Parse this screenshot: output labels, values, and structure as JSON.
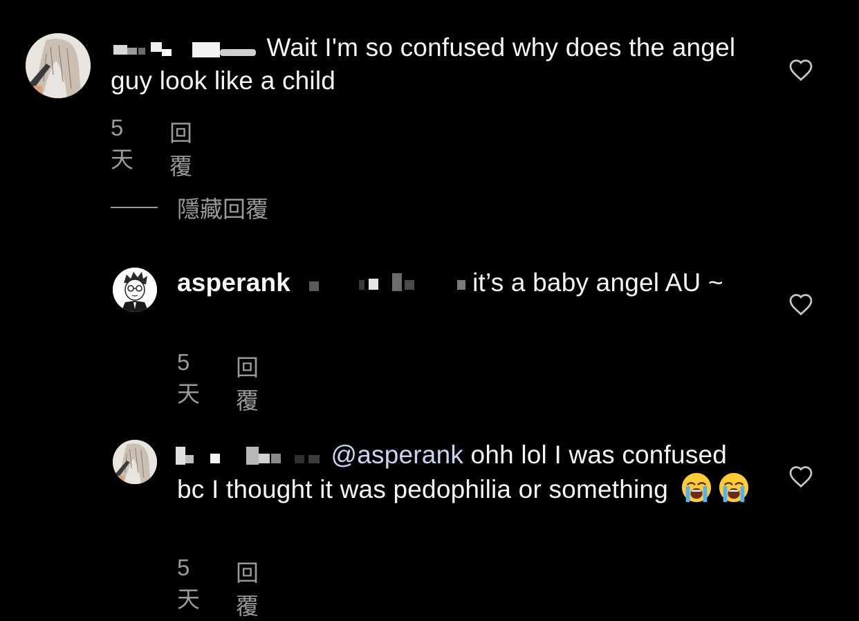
{
  "comments": [
    {
      "text": "Wait I'm so confused why does the angel guy look like a child",
      "time": "5天",
      "reply": "回覆"
    },
    {
      "username": "asperank",
      "text": "it’s a baby angel AU ~",
      "time": "5天",
      "reply": "回覆"
    },
    {
      "mention": "@asperank",
      "text_line1": "ohh lol I was",
      "text_rest": "confused bc I thought it was pedophilia or something",
      "time": "5天",
      "reply": "回覆"
    }
  ],
  "hide_replies_label": "隱藏回覆",
  "icons": {
    "like": "heart-outline-icon",
    "emoji": "loudly-crying-face-emoji"
  },
  "colors": {
    "background": "#000000",
    "text": "#f5f5f5",
    "meta": "#9a9a9a",
    "mention": "#c8d4f0"
  }
}
